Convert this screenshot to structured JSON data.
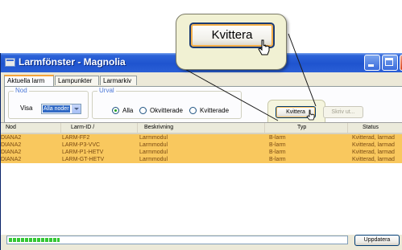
{
  "window": {
    "title": "Larmfönster - Magnolia"
  },
  "tabs": [
    {
      "label": "Aktuella larm",
      "active": true
    },
    {
      "label": "Lampunkter",
      "active": false
    },
    {
      "label": "Larmarkiv",
      "active": false
    }
  ],
  "filters": {
    "nod_group_label": "Nod",
    "visa_label": "Visa",
    "visa_value": "Alla noder",
    "urval_group_label": "Urval",
    "radios": [
      {
        "label": "Alla",
        "checked": true
      },
      {
        "label": "Okvitterade",
        "checked": false
      },
      {
        "label": "Kvitterade",
        "checked": false
      }
    ]
  },
  "actions": {
    "kvittera_label": "Kvittera",
    "skriv_ut_label": "Skriv ut..."
  },
  "callout": {
    "button_label": "Kvittera"
  },
  "table": {
    "columns": [
      "Nod",
      "Larm-ID /",
      "Beskrivning",
      "Typ",
      "Status"
    ],
    "rows": [
      [
        "DIANA2",
        "LARM-FF2",
        "Larmmodul",
        "B-larm",
        "Kvitterad, larmad"
      ],
      [
        "DIANA2",
        "LARM-P3-VVC",
        "Larmmodul",
        "B-larm",
        "Kvitterad, larmad"
      ],
      [
        "DIANA2",
        "LARM-P1-HETV",
        "Larmmodul",
        "B-larm",
        "Kvitterad, larmad"
      ],
      [
        "DIANA2",
        "LARM-GT-HETV",
        "Larmmodul",
        "B-larm",
        "Kvitterad, larmad"
      ]
    ],
    "row_color": "#f9c85e"
  },
  "footer": {
    "update_label": "Uppdatera",
    "progress_fraction": 0.15
  },
  "colors": {
    "titlebar": "#2d63d8",
    "accent": "#f5a43a",
    "row_highlight": "#f9c85e"
  }
}
